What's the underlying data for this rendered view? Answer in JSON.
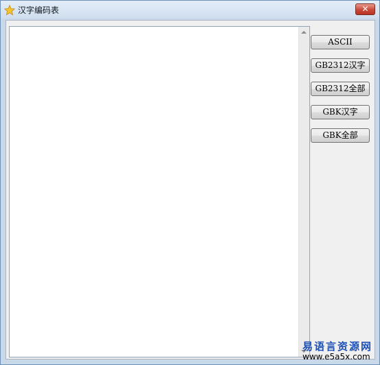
{
  "window": {
    "title": "汉字编码表",
    "close_label": "✕"
  },
  "buttons": [
    {
      "label": "ASCII"
    },
    {
      "label": "GB2312汉字"
    },
    {
      "label": "GB2312全部"
    },
    {
      "label": "GBK汉字"
    },
    {
      "label": "GBK全部"
    }
  ],
  "textarea": {
    "value": ""
  },
  "watermark": {
    "site_name": "易语言资源网",
    "url": "www.e5a5x.com"
  },
  "colors": {
    "title_bar": "#cfdeee",
    "close_button": "#c9493a",
    "client_bg": "#f0f0f0",
    "watermark_text": "#1e50b4"
  },
  "icons": {
    "app": "star-icon",
    "close": "close-icon"
  }
}
